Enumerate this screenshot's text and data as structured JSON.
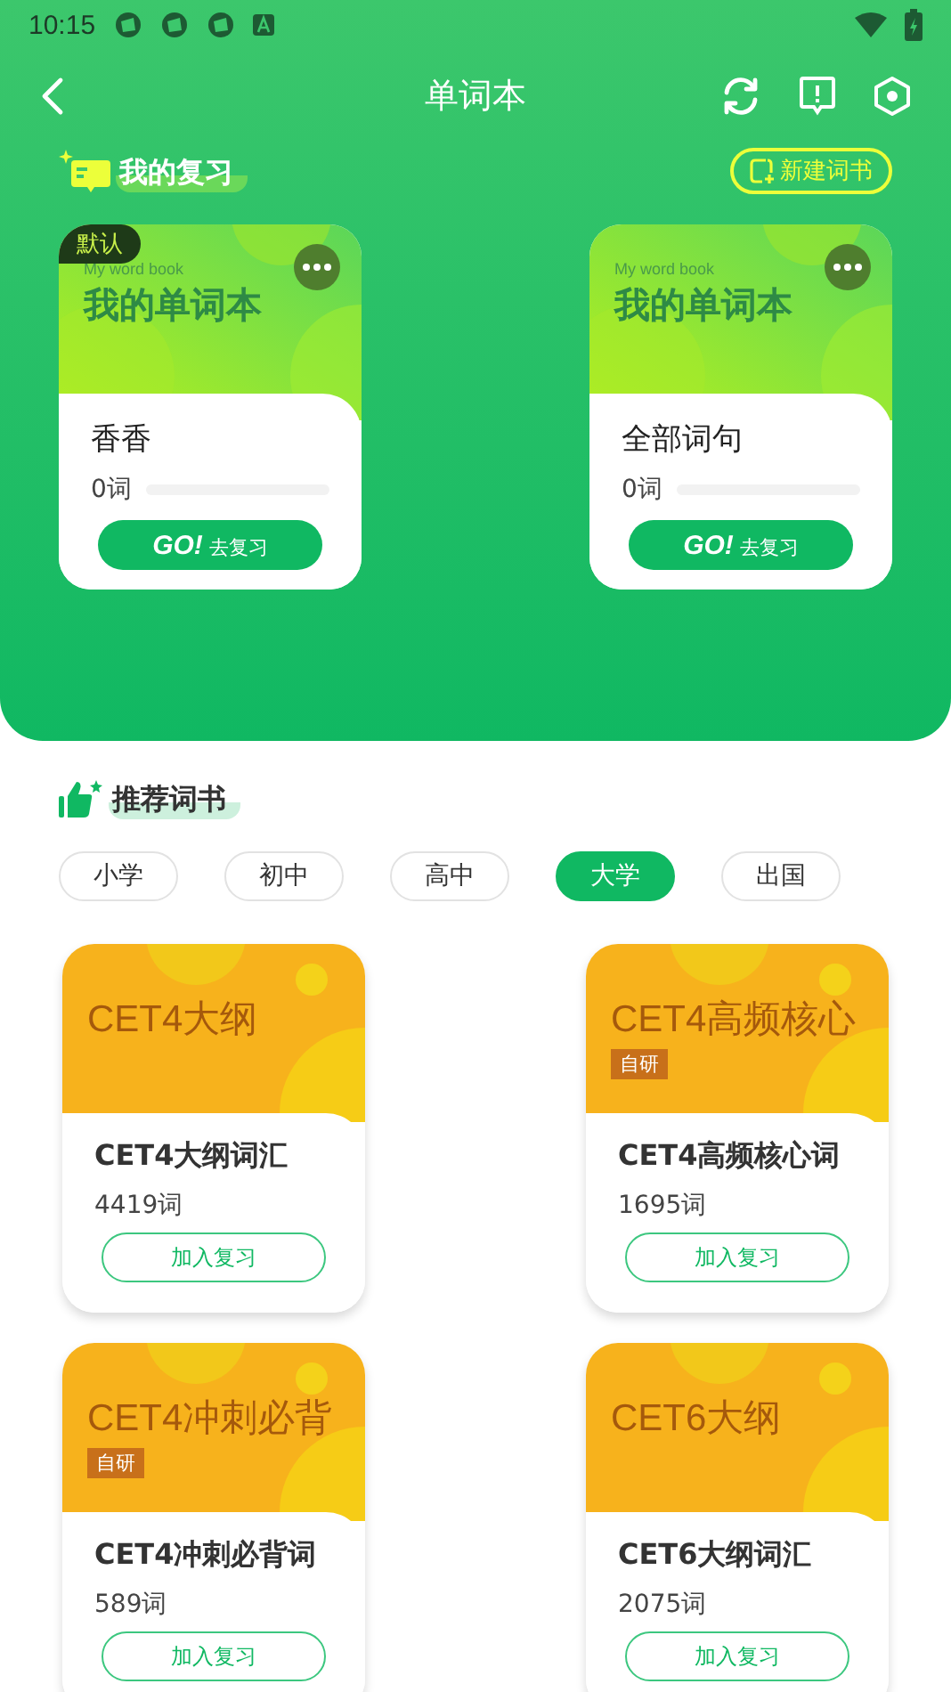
{
  "status_bar": {
    "time": "10:15"
  },
  "header": {
    "title": "单词本"
  },
  "my_review": {
    "title": "我的复习",
    "new_button": "新建词书",
    "books": [
      {
        "default_badge": "默认",
        "cover_subtitle": "My word book",
        "cover_title": "我的单词本",
        "name": "香香",
        "count": "0词",
        "level": 0,
        "go": "GO!",
        "go_label": "去复习"
      },
      {
        "cover_subtitle": "My word book",
        "cover_title": "我的单词本",
        "name": "全部词句",
        "count": "0词",
        "level": 0,
        "go": "GO!",
        "go_label": "去复习"
      }
    ]
  },
  "recommended": {
    "title": "推荐词书",
    "tabs": [
      {
        "label": "小学",
        "selected": false
      },
      {
        "label": "初中",
        "selected": false
      },
      {
        "label": "高中",
        "selected": false
      },
      {
        "label": "大学",
        "selected": true
      },
      {
        "label": "出国",
        "selected": false
      }
    ],
    "books": [
      {
        "cover_title": "CET4大纲",
        "title": "CET4大纲词汇",
        "count": "4419词",
        "button": "加入复习"
      },
      {
        "cover_title": "CET4高频核心",
        "tag": "自研",
        "title": "CET4高频核心词",
        "count": "1695词",
        "button": "加入复习"
      },
      {
        "cover_title": "CET4冲刺必背",
        "tag": "自研",
        "title": "CET4冲刺必背词",
        "count": "589词",
        "button": "加入复习"
      },
      {
        "cover_title": "CET6大纲",
        "title": "CET6大纲词汇",
        "count": "2075词",
        "button": "加入复习"
      }
    ]
  }
}
